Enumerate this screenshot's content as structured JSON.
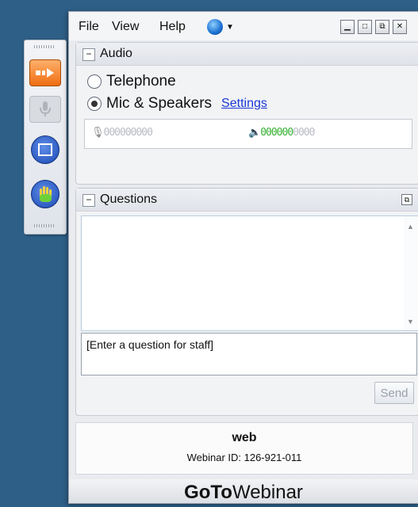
{
  "menu": {
    "file": "File",
    "view": "View",
    "help": "Help"
  },
  "window_controls": {
    "minimize": "▁",
    "maximize": "□",
    "popout": "⧉",
    "close": "✕"
  },
  "audio": {
    "title": "Audio",
    "collapse": "−",
    "telephone_label": "Telephone",
    "mic_speakers_label": "Mic & Speakers",
    "selected": "mic_speakers",
    "settings_link": "Settings",
    "mic_level": "000000000",
    "speaker_level_on": "000000",
    "speaker_level_off": "0000"
  },
  "questions": {
    "title": "Questions",
    "collapse": "−",
    "input_placeholder": "[Enter a question for staff]",
    "send_label": "Send"
  },
  "webinar": {
    "name": "web",
    "id_text": "Webinar ID: 126-921-011"
  },
  "brand": {
    "bold": "GoTo",
    "normal": "Webinar"
  },
  "icons": {
    "arrow": "orange-arrow-icon",
    "mic": "microphone-icon",
    "screen": "screen-share-icon",
    "hand": "raise-hand-icon",
    "globe": "globe-icon"
  },
  "colors": {
    "background": "#2e5f86",
    "accent_orange": "#ef6d12",
    "link": "#1a38d6",
    "meter_green": "#36b132"
  }
}
